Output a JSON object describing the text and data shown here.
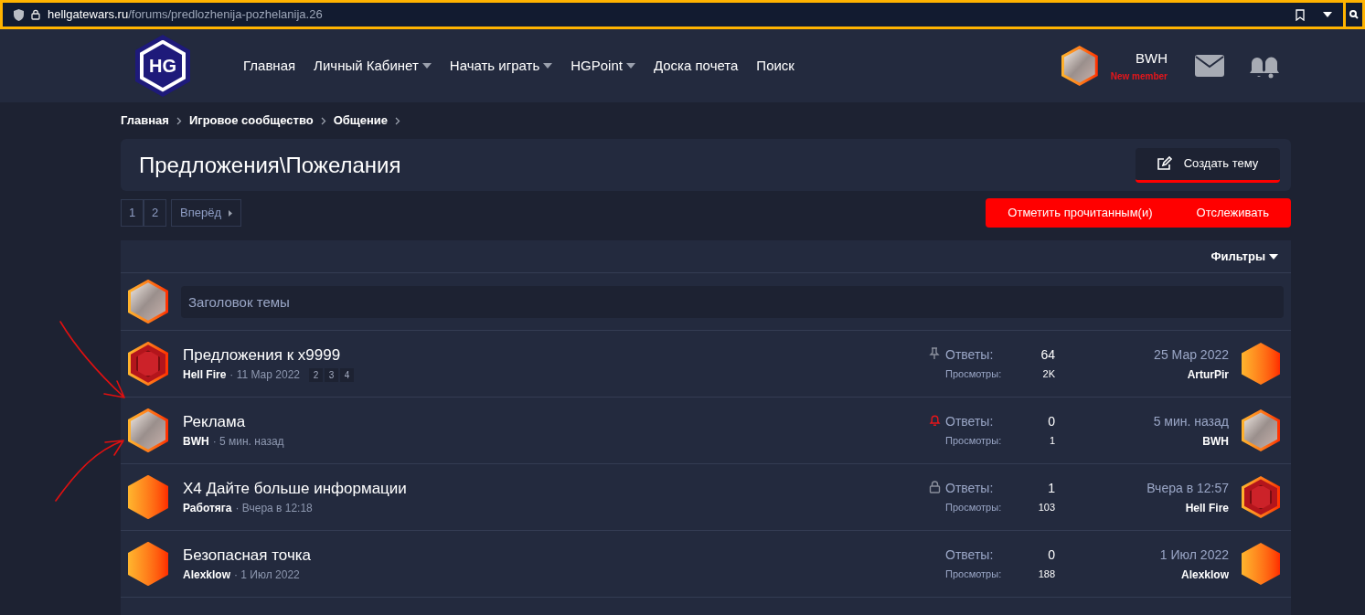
{
  "browser": {
    "url_domain": "hellgatewars.ru",
    "url_path": "/forums/predlozhenija-pozhelanija.26"
  },
  "logo": {
    "text": "HG"
  },
  "nav": [
    {
      "label": "Главная",
      "dropdown": false
    },
    {
      "label": "Личный Кабинет",
      "dropdown": true
    },
    {
      "label": "Начать играть",
      "dropdown": true
    },
    {
      "label": "HGPoint",
      "dropdown": true
    },
    {
      "label": "Доска почета",
      "dropdown": false
    },
    {
      "label": "Поиск",
      "dropdown": false
    }
  ],
  "user": {
    "name": "BWH",
    "title": "New member"
  },
  "breadcrumbs": [
    "Главная",
    "Игровое сообщество",
    "Общение"
  ],
  "page_title": "Предложения\\Пожелания",
  "create_button": "Создать тему",
  "pagination": {
    "pages": [
      "1",
      "2"
    ],
    "next": "Вперёд"
  },
  "actions": [
    "Отметить прочитанным(и)",
    "Отслеживать"
  ],
  "filters": "Фильтры",
  "new_topic": {
    "placeholder": "Заголовок темы"
  },
  "threads": [
    {
      "title": "Предложения к x9999",
      "author": "Hell Fire",
      "date": "· 11 Мар 2022",
      "pages": [
        "2",
        "3",
        "4"
      ],
      "status_icon": {
        "kind": "pinned"
      },
      "avatar": {
        "kind": "logo"
      },
      "replies_label": "Ответы:",
      "replies": "64",
      "views_label": "Просмотры:",
      "views": "2K",
      "last_date": "25 Мар 2022",
      "last_user": "ArturPir",
      "last_avatar": {
        "kind": "blank"
      }
    },
    {
      "title": "Реклама",
      "author": "BWH",
      "date": "· 5 мин. назад",
      "status_icon": {
        "kind": "watched"
      },
      "avatar": {
        "kind": "photo"
      },
      "replies_label": "Ответы:",
      "replies": "0",
      "views_label": "Просмотры:",
      "views": "1",
      "last_date": "5 мин. назад",
      "last_user": "BWH",
      "last_avatar": {
        "kind": "photo"
      }
    },
    {
      "title": "X4 Дайте больше информации",
      "author": "Работяга",
      "date": "· Вчера в 12:18",
      "status_icon": {
        "kind": "locked"
      },
      "avatar": {
        "kind": "blank"
      },
      "replies_label": "Ответы:",
      "replies": "1",
      "views_label": "Просмотры:",
      "views": "103",
      "last_date": "Вчера в 12:57",
      "last_user": "Hell Fire",
      "last_avatar": {
        "kind": "logo"
      }
    },
    {
      "title": "Безопасная точка",
      "author": "Alexklow",
      "date": "· 1 Июл 2022",
      "avatar": {
        "kind": "blank"
      },
      "replies_label": "Ответы:",
      "replies": "0",
      "views_label": "Просмотры:",
      "views": "188",
      "last_date": "1 Июл 2022",
      "last_user": "Alexklow",
      "last_avatar": {
        "kind": "blank"
      }
    }
  ]
}
